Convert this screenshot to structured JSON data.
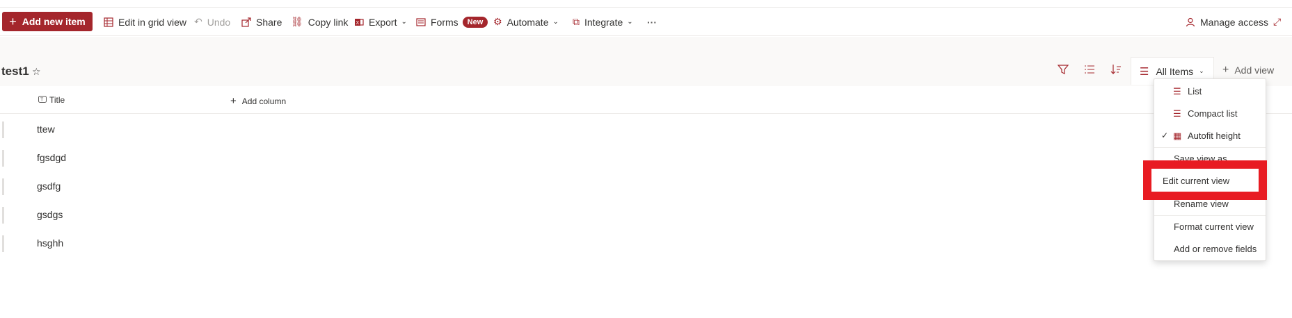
{
  "toolbar": {
    "add_new_item": "Add new item",
    "edit_grid": "Edit in grid view",
    "undo": "Undo",
    "share": "Share",
    "copy_link": "Copy link",
    "export": "Export",
    "forms": "Forms",
    "forms_badge": "New",
    "automate": "Automate",
    "integrate": "Integrate",
    "more": "···",
    "manage_access": "Manage access"
  },
  "list": {
    "title": "test1",
    "current_view": "All Items",
    "add_view": "Add view"
  },
  "columns": {
    "title": "Title",
    "add_column": "Add column"
  },
  "rows": [
    "ttew",
    "fgsdgd",
    "gsdfg",
    "gsdgs",
    "hsghh"
  ],
  "view_menu": {
    "list": "List",
    "compact_list": "Compact list",
    "autofit_height": "Autofit height",
    "save_view_as": "Save view as",
    "edit_current_view": "Edit current view",
    "rename_view": "Rename view",
    "format_current_view": "Format current view",
    "add_remove_fields": "Add or remove fields"
  },
  "colors": {
    "accent": "#a4262c",
    "highlight": "#e81b22"
  }
}
